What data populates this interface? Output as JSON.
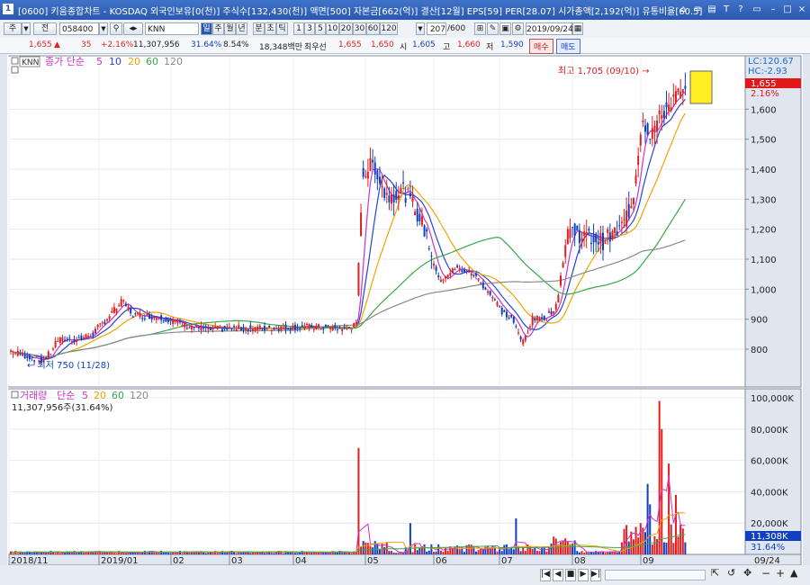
{
  "window": {
    "icon_text": "1",
    "title": "[0600] 키움종합차트 - KOSDAQ 외국인보유[0(천)] 주식수[132,430(천)] 액면[500] 자본금[662(억)] 결산[12월] EPS[59] PER[28.07] 시가총액[2,192(억)] 유통비율[60.5]"
  },
  "toolbar": {
    "period_main": "주",
    "period_select": "전",
    "code_value": "058400",
    "name_value": "KNN",
    "intervals": [
      "일",
      "주",
      "월",
      "년",
      "분",
      "초",
      "틱"
    ],
    "minute_options": [
      "1",
      "3",
      "5",
      "10",
      "20",
      "30",
      "60",
      "120"
    ],
    "count_value": "207",
    "count_total": "/600",
    "date_value": "2019/09/24",
    "buy_label": "매수",
    "sell_label": "매도"
  },
  "infobar": {
    "price": "1,655",
    "change": "35",
    "change_pct": "+2.16%",
    "volume": "11,307,956",
    "volume_pct": "31.64%",
    "turnover": "8.54%",
    "trade_value": "18,348백만",
    "prio_label": "최우선",
    "ask": "1,655",
    "bid": "1,650",
    "open_label": "시",
    "open": "1,605",
    "high_label": "고",
    "high": "1,660",
    "low_label": "저",
    "low": "1,590"
  },
  "price_panel": {
    "name_tag": "KNN",
    "legend_label": "종가 단순",
    "ma_periods": [
      "5",
      "10",
      "20",
      "60",
      "120"
    ],
    "ma_colors": [
      "#cc33cc",
      "#2a44d6",
      "#f0a400",
      "#3aa84a",
      "#8a8a8a"
    ],
    "lc": "LC:120.67",
    "hc": "HC:-2.93",
    "current_price": "1,655",
    "current_pct": "2.16%",
    "high_annot": "최고 1,705 (09/10) →",
    "low_annot": "← 최저 750 (11/28)",
    "y_ticks": [
      "1,600",
      "1,500",
      "1,400",
      "1,300",
      "1,200",
      "1,100",
      "1,000",
      "900",
      "800"
    ]
  },
  "volume_panel": {
    "legend_label": "거래량",
    "legend_ma": "단순",
    "ma_periods": [
      "5",
      "20",
      "60",
      "120"
    ],
    "readout": "11,307,956주(31.64%)",
    "y_ticks": [
      "100,000K",
      "80,000K",
      "60,000K",
      "40,000K",
      "20,000K"
    ],
    "current_vol": "11,308K",
    "current_pct": "31.64%"
  },
  "x_axis": {
    "labels": [
      "2018/11",
      "2019/01",
      "02",
      "03",
      "04",
      "05",
      "06",
      "07",
      "08",
      "09"
    ],
    "right_label": "09/24"
  },
  "colors": {
    "up": "#e02020",
    "down": "#1040c0",
    "title_bg": "#2a58ad",
    "price_tag_bg": "#e01818"
  },
  "chart_data": {
    "type": "candlestick",
    "title": "",
    "series": [
      {
        "name": "KNN",
        "x_range": [
          "2018/11",
          "2019/09/24"
        ],
        "close_last": 1655,
        "high_max": 1705,
        "low_min": 750
      },
      {
        "name": "5",
        "kind": "moving-average"
      },
      {
        "name": "10",
        "kind": "moving-average"
      },
      {
        "name": "20",
        "kind": "moving-average"
      },
      {
        "name": "60",
        "kind": "moving-average"
      },
      {
        "name": "120",
        "kind": "moving-average"
      }
    ],
    "ylim": [
      750,
      1750
    ],
    "volume_ylim": [
      0,
      100000
    ]
  }
}
